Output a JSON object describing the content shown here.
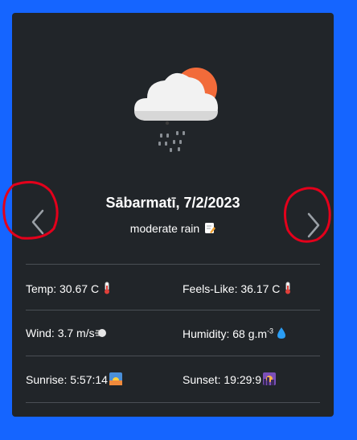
{
  "card": {
    "title": "Sābarmatī, 7/2/2023",
    "description": "moderate rain",
    "weather_icon": "cloud-sun-rain-icon",
    "nav": {
      "prev_icon": "chevron-left-icon",
      "next_icon": "chevron-right-icon",
      "annotation_color": "#e3001b"
    },
    "stats": {
      "temp": {
        "label": "Temp:",
        "value": "30.67 C",
        "icon": "thermometer-icon"
      },
      "feels_like": {
        "label": "Feels-Like:",
        "value": "36.17 C",
        "icon": "thermometer-icon"
      },
      "wind": {
        "label": "Wind:",
        "value": "3.7 m/s",
        "icon": "wind-icon"
      },
      "humidity": {
        "label": "Humidity:",
        "value": "68 g.m",
        "unit_sup": "-3",
        "icon": "droplet-icon"
      },
      "sunrise": {
        "label": "Sunrise:",
        "value": "5:57:14",
        "icon": "sunrise-icon"
      },
      "sunset": {
        "label": "Sunset:",
        "value": "19:29:9",
        "icon": "sunset-icon"
      }
    }
  },
  "colors": {
    "page_background": "#1565ff",
    "card_background": "#212529",
    "divider": "#4a4f55",
    "sun": "#f26b3a"
  }
}
